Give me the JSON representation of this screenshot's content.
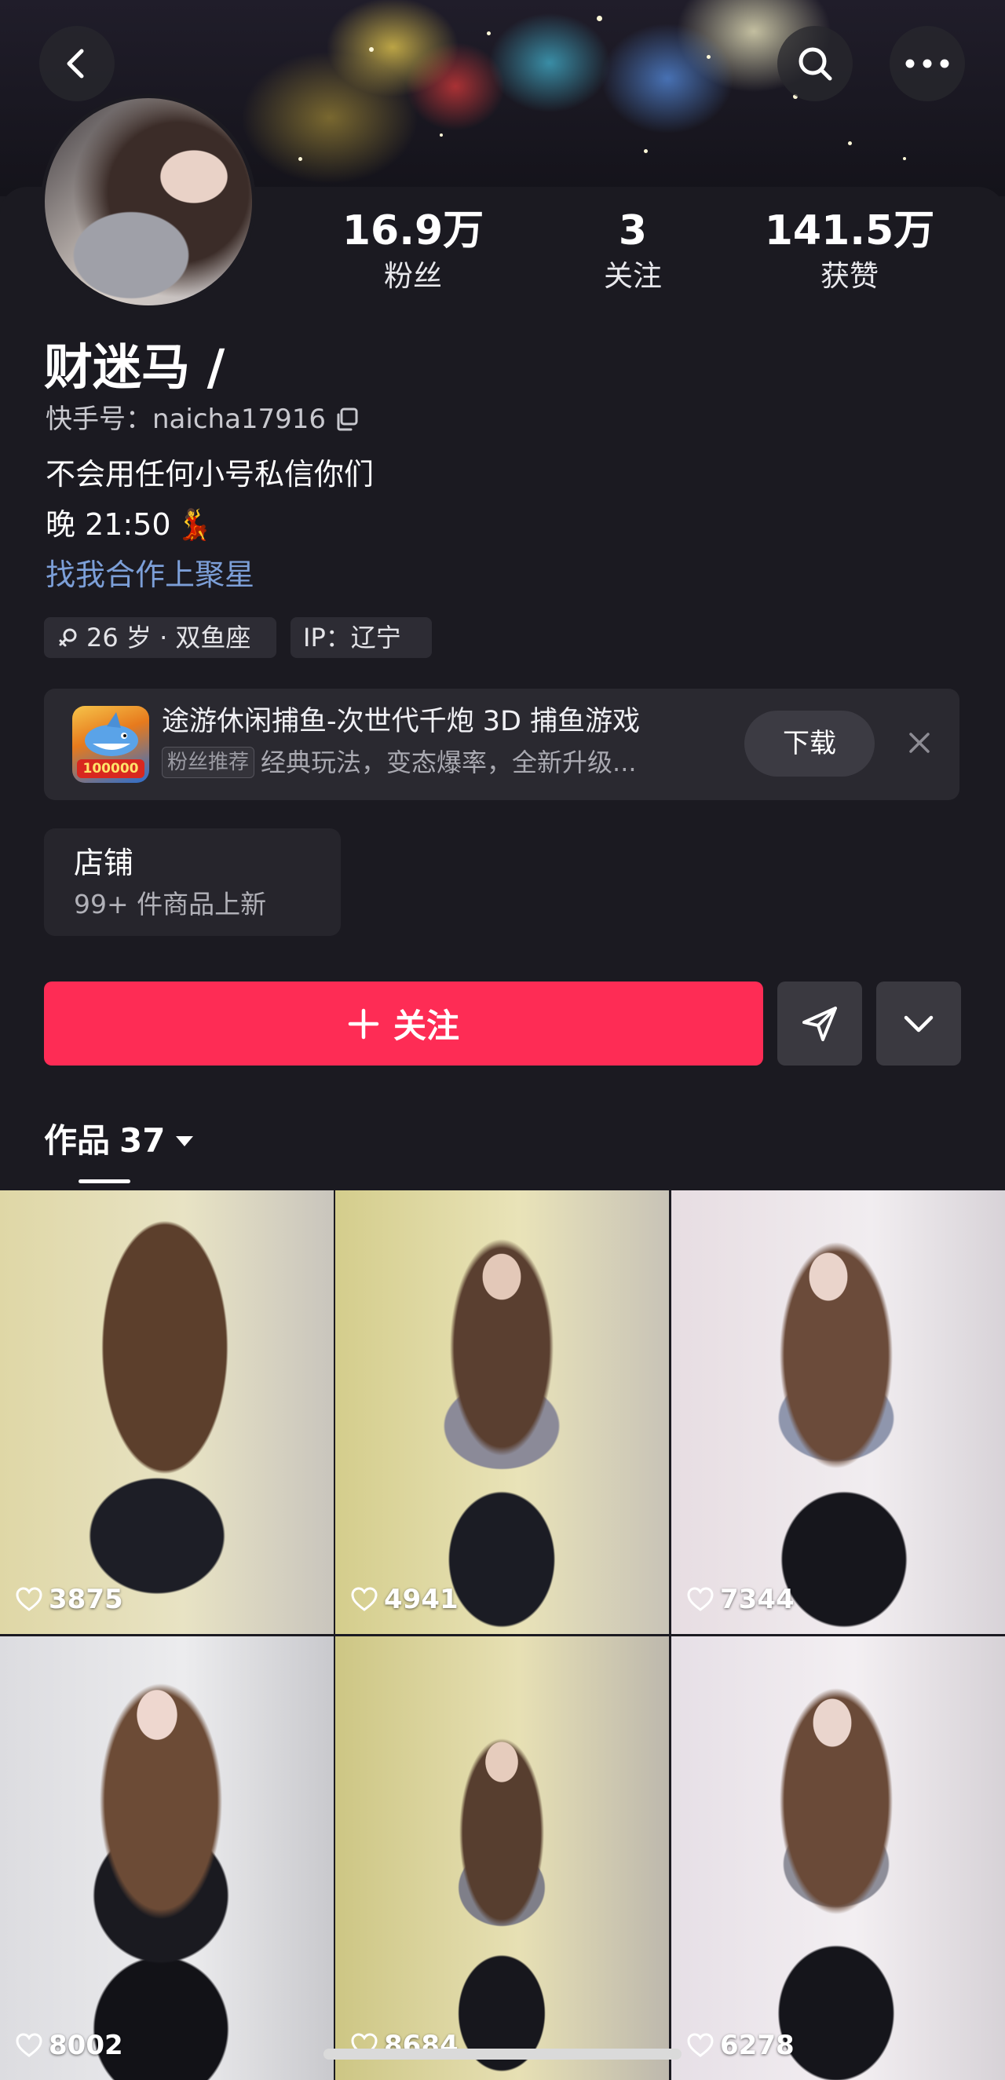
{
  "header": {
    "back_icon": "chevron-left-icon",
    "search_icon": "search-icon",
    "more_icon": "more-horizontal-icon"
  },
  "profile": {
    "stats": [
      {
        "value": "16.9万",
        "label": "粉丝"
      },
      {
        "value": "3",
        "label": "关注"
      },
      {
        "value": "141.5万",
        "label": "获赞"
      }
    ],
    "nickname": "财迷马 /",
    "kuaishou_id_label": "快手号：naicha17916",
    "bio_line1": "不会用任何小号私信你们",
    "bio_line2": "晚 21:50",
    "bio_line2_emoji": "💃",
    "bio_link": "找我合作上聚星",
    "tags": {
      "age": "26 岁 · 双鱼座",
      "ip": "IP：辽宁"
    }
  },
  "ad": {
    "title": "途游休闲捕鱼-次世代千炮 3D 捕鱼游戏",
    "badge": "粉丝推荐",
    "subtitle": "经典玩法，变态爆率，全新升级...",
    "icon_badge": "100000",
    "download_label": "下载"
  },
  "shop": {
    "title": "店铺",
    "subtitle": "99+ 件商品上新"
  },
  "actions": {
    "follow_label": "关注"
  },
  "works": {
    "tab_label": "作品",
    "count": "37",
    "items": [
      {
        "likes": "3875"
      },
      {
        "likes": "4941"
      },
      {
        "likes": "7344"
      },
      {
        "likes": "8002"
      },
      {
        "likes": "8684"
      },
      {
        "likes": "6278"
      }
    ]
  },
  "colors": {
    "background": "#1b1a21",
    "accent": "#fe2c55",
    "link": "#7c9fd8"
  }
}
